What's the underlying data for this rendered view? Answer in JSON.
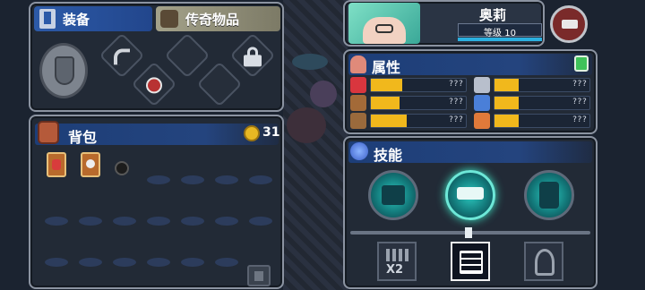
{
  "equipment": {
    "tab_equip_label": "装备",
    "tab_legendary_label": "传奇物品"
  },
  "bag": {
    "title": "背包",
    "coins": "31"
  },
  "character": {
    "name": "奥莉",
    "level_label": "等级 10",
    "level": 10
  },
  "attributes": {
    "title": "属性",
    "stats": [
      {
        "icon": "heart-icon",
        "value_label": "???",
        "fill": 0.33,
        "color": "#d9363e"
      },
      {
        "icon": "sword-icon",
        "value_label": "???",
        "fill": 0.25,
        "color": "#b8bfcc"
      },
      {
        "icon": "shield-icon",
        "value_label": "???",
        "fill": 0.3,
        "color": "#a36a38"
      },
      {
        "icon": "eye-icon",
        "value_label": "???",
        "fill": 0.25,
        "color": "#4a7fd8"
      },
      {
        "icon": "armor-icon",
        "value_label": "???",
        "fill": 0.38,
        "color": "#9a6a3c"
      },
      {
        "icon": "crystal-icon",
        "value_label": "???",
        "fill": 0.25,
        "color": "#e07a3a"
      }
    ]
  },
  "skills": {
    "title": "技能",
    "x2_label": "X2"
  },
  "colors": {
    "panel_border": "#8b93a1",
    "header_blue": "#1d3e78",
    "stat_fill": "#f1b81c",
    "skill_glow": "#3fe7c7"
  }
}
